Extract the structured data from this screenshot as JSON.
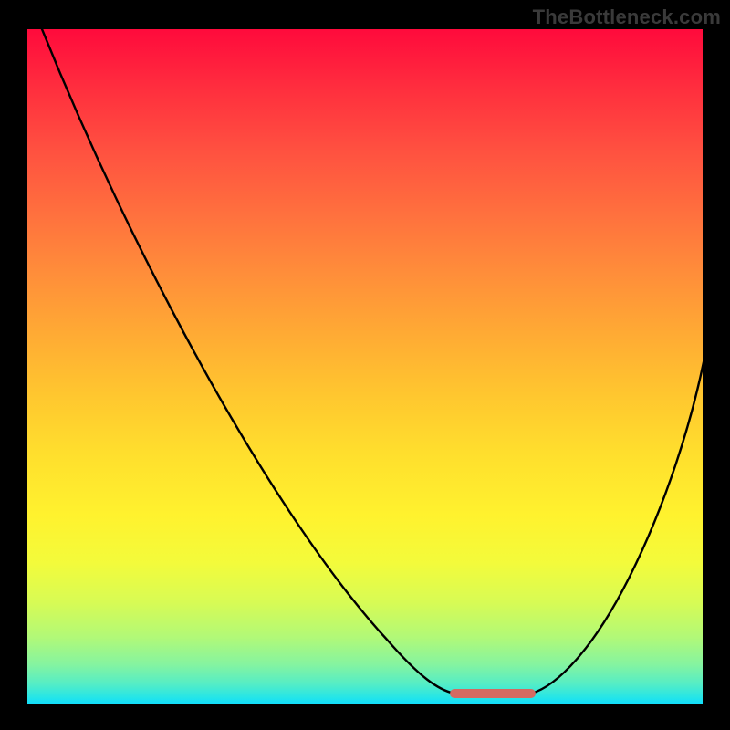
{
  "watermark": "TheBottleneck.com",
  "colors": {
    "background": "#000000",
    "gradient_top": "#ff0a3c",
    "gradient_mid": "#ffdf2d",
    "gradient_bottom": "#0edcff",
    "curve": "#000000",
    "optimal_marker": "#d46a61",
    "watermark": "#3a3a3a"
  },
  "chart_data": {
    "type": "line",
    "title": "",
    "xlabel": "",
    "ylabel": "",
    "xlim": [
      0,
      100
    ],
    "ylim": [
      0,
      100
    ],
    "grid": false,
    "legend": false,
    "series": [
      {
        "name": "bottleneck-curve",
        "x": [
          1,
          6,
          12,
          18,
          24,
          30,
          36,
          42,
          48,
          54,
          60,
          63,
          66,
          70,
          75,
          80,
          86,
          92,
          98
        ],
        "values": [
          100,
          93,
          84,
          74,
          64,
          54,
          44,
          34,
          24,
          15,
          7,
          3,
          1,
          1,
          1,
          5,
          14,
          28,
          47
        ]
      }
    ],
    "annotations": [
      {
        "name": "optimal-range",
        "x_start": 63,
        "x_end": 75,
        "y": 1
      }
    ],
    "notes": "Axes carry no visible tick labels; x/y are normalized 0-100 fractions of the plot area. Gradient encodes bottleneck severity (red high, teal low). Salmon segment marks the flat minimum."
  }
}
